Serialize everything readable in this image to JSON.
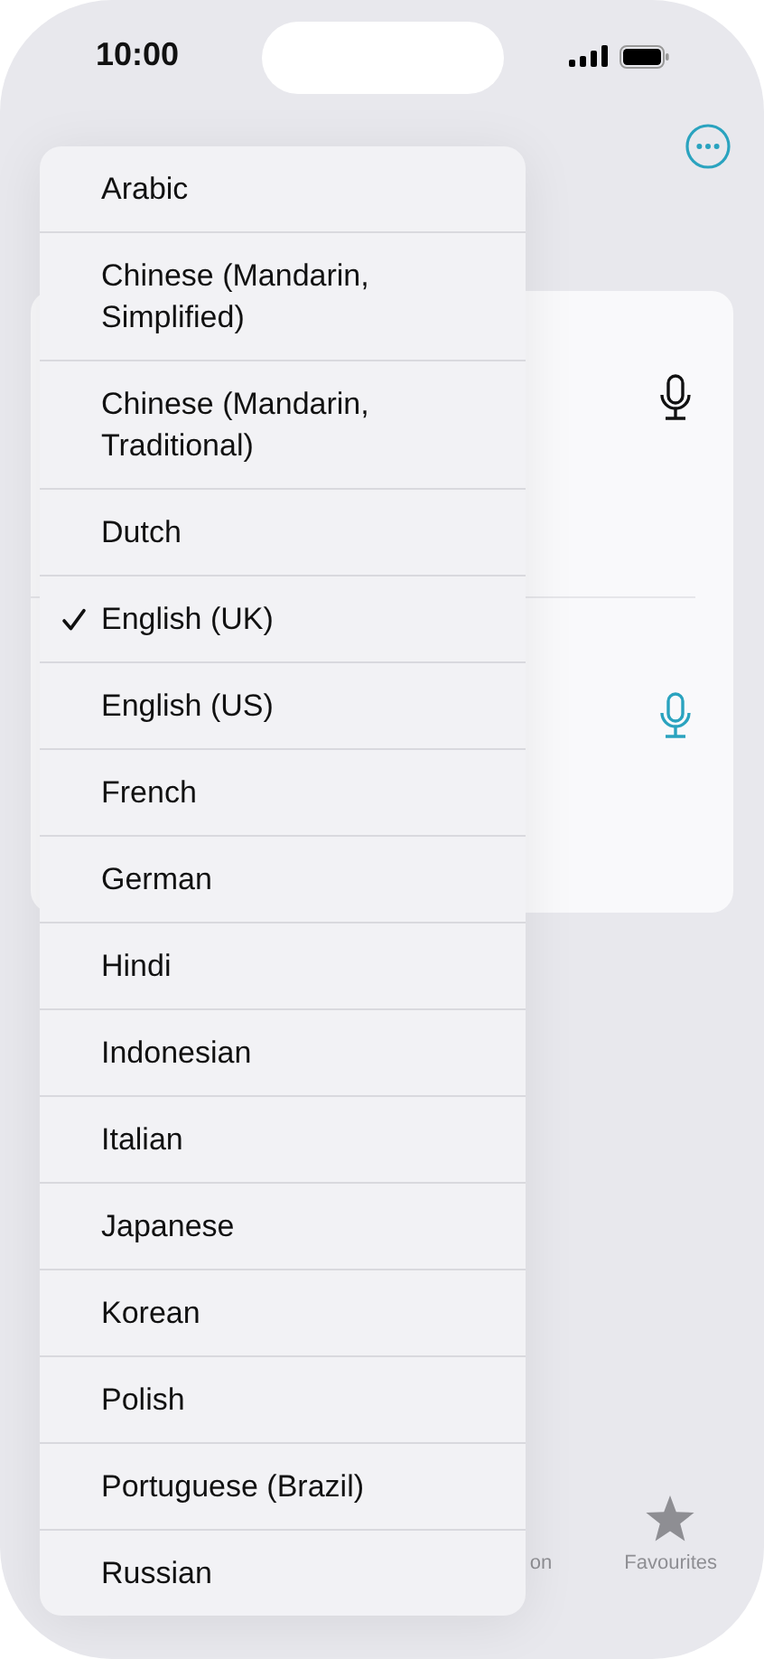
{
  "status_bar": {
    "time": "10:00"
  },
  "mic_rows": [
    {
      "active": false
    },
    {
      "active": true
    }
  ],
  "tab_bar": {
    "tabs": [
      {
        "label": "on",
        "kind": "hidden"
      },
      {
        "label": "Favourites",
        "kind": "star"
      }
    ]
  },
  "language_menu": {
    "items": [
      {
        "label": "Arabic",
        "selected": false
      },
      {
        "label": "Chinese (Mandarin, Simplified)",
        "selected": false
      },
      {
        "label": "Chinese (Mandarin, Traditional)",
        "selected": false
      },
      {
        "label": "Dutch",
        "selected": false
      },
      {
        "label": "English (UK)",
        "selected": true
      },
      {
        "label": "English (US)",
        "selected": false
      },
      {
        "label": "French",
        "selected": false
      },
      {
        "label": "German",
        "selected": false
      },
      {
        "label": "Hindi",
        "selected": false
      },
      {
        "label": "Indonesian",
        "selected": false
      },
      {
        "label": "Italian",
        "selected": false
      },
      {
        "label": "Japanese",
        "selected": false
      },
      {
        "label": "Korean",
        "selected": false
      },
      {
        "label": "Polish",
        "selected": false
      },
      {
        "label": "Portuguese (Brazil)",
        "selected": false
      },
      {
        "label": "Russian",
        "selected": false
      }
    ]
  }
}
